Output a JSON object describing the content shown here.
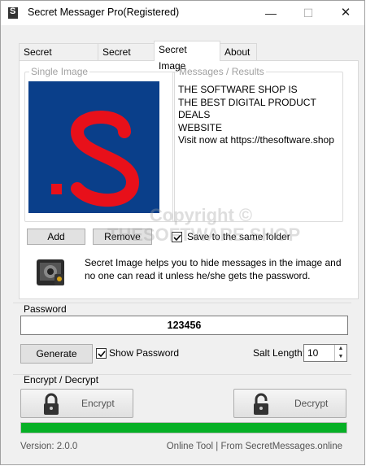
{
  "window": {
    "title": "Secret Messager Pro(Registered)",
    "min_symbol": "—",
    "max_symbol": "☐",
    "close_symbol": "✕"
  },
  "tabs": [
    {
      "label": "Secret Messages",
      "active": false
    },
    {
      "label": "Secret Files",
      "active": false
    },
    {
      "label": "Secret Image",
      "active": true
    },
    {
      "label": "About",
      "active": false
    }
  ],
  "single_image": {
    "legend": "Single Image",
    "image_bg": "#0a3f8a",
    "glyph_color": "#e8101a"
  },
  "results": {
    "legend": "Messages / Results",
    "text": "THE SOFTWARE SHOP IS\nTHE BEST DIGITAL PRODUCT DEALS\n WEBSITE\nVisit now at https://thesoftware.shop"
  },
  "buttons": {
    "add": "Add",
    "remove": "Remove",
    "generate": "Generate",
    "encrypt": "Encrypt",
    "decrypt": "Decrypt"
  },
  "save_same_folder": {
    "label": "Save to the same folder",
    "checked": true
  },
  "info": {
    "text": "Secret Image helps you to hide messages in the image and no one can read it unless he/she gets the password.",
    "icon": "camera-icon"
  },
  "watermark": {
    "line1": "Copyright ©",
    "line2": "THESOFTWARE.SHOP"
  },
  "password": {
    "label": "Password",
    "value": "123456"
  },
  "show_password": {
    "label": "Show Password",
    "checked": true
  },
  "salt": {
    "label": "Salt Length:",
    "value": "10"
  },
  "encrypt_section": {
    "label": "Encrypt / Decrypt"
  },
  "progress": {
    "percent": 100,
    "color": "#06b025"
  },
  "footer": {
    "version": "Version: 2.0.0",
    "link": "Online Tool | From SecretMessages.online"
  }
}
